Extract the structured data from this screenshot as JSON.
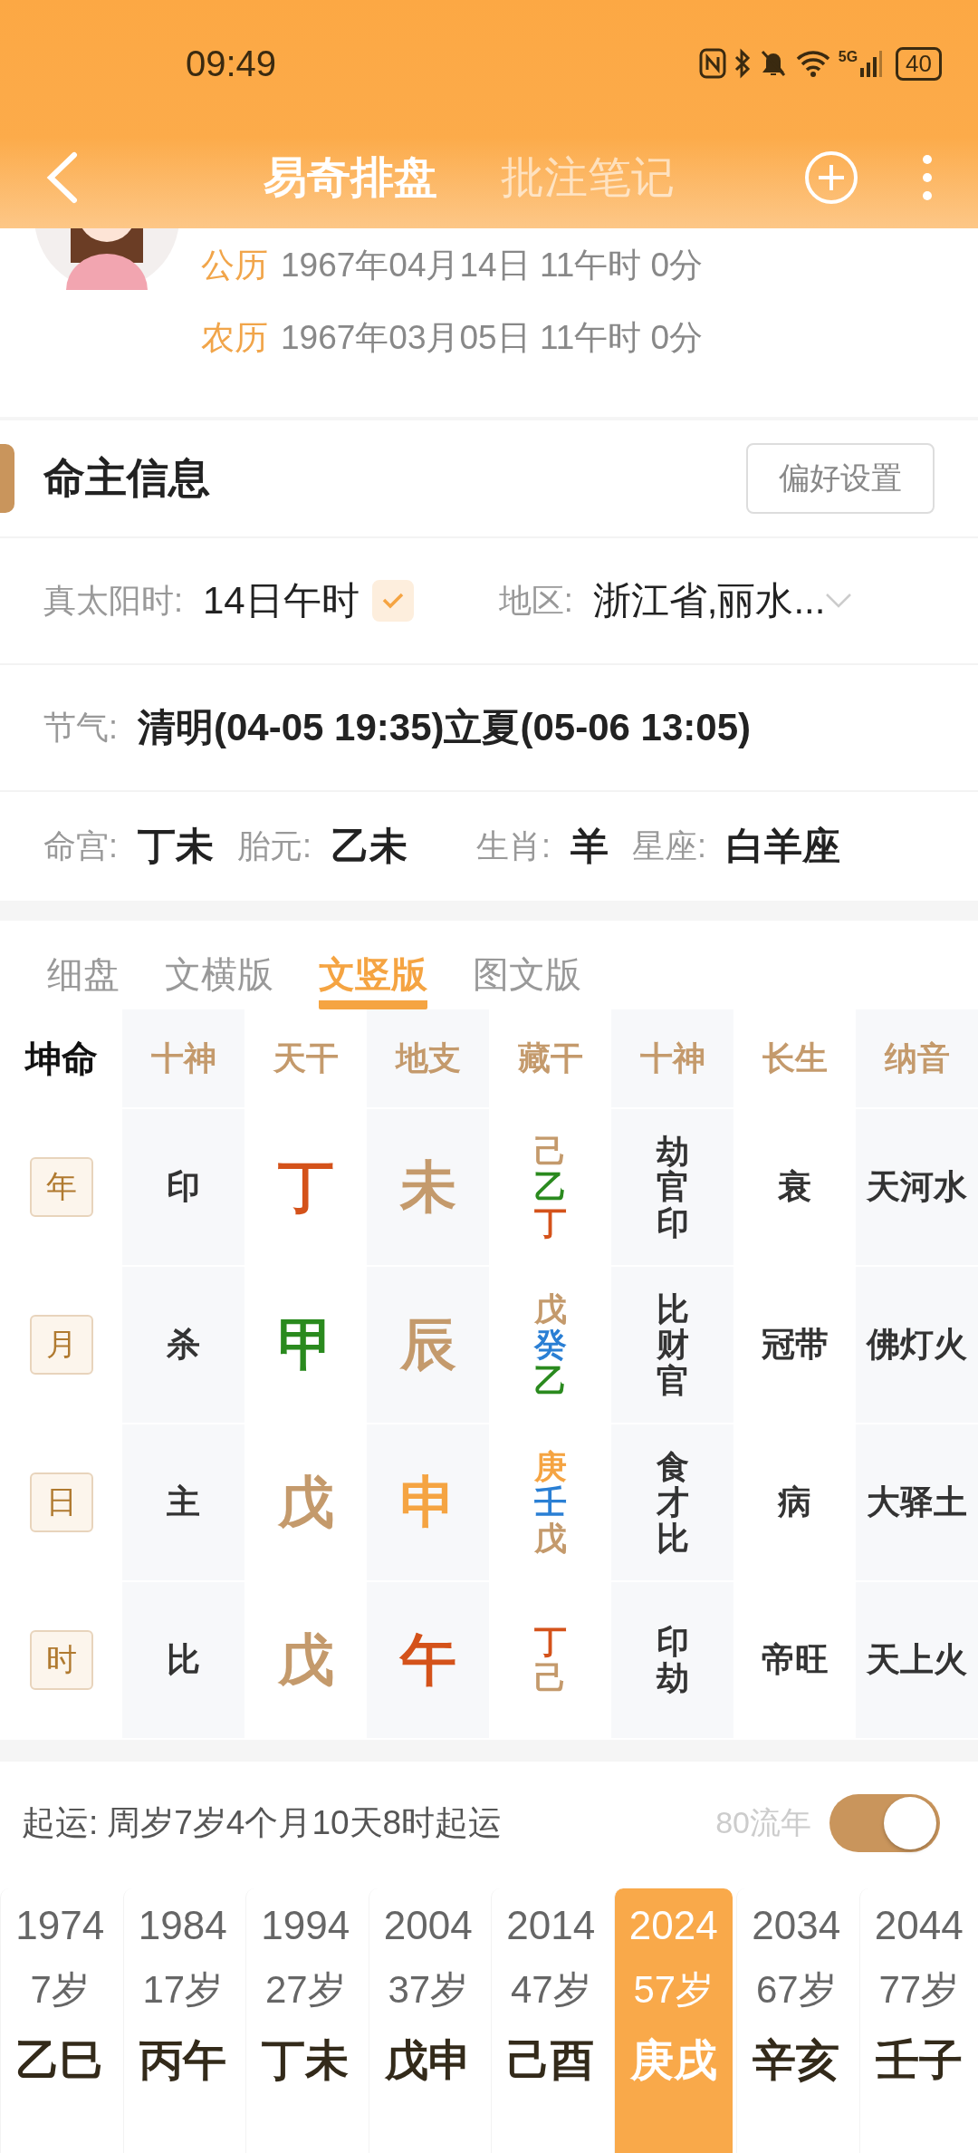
{
  "status_bar": {
    "time": "09:49",
    "network": "5G",
    "battery": "40"
  },
  "nav": {
    "tabs": [
      {
        "label": "易奇排盘",
        "selected": true
      },
      {
        "label": "批注笔记",
        "selected": false
      }
    ]
  },
  "profile": {
    "dates": [
      {
        "label": "公历",
        "value": "1967年04月14日 11午时 0分"
      },
      {
        "label": "农历",
        "value": "1967年03月05日 11午时 0分"
      }
    ]
  },
  "info": {
    "title": "命主信息",
    "button": "偏好设置",
    "solar_time": {
      "label": "真太阳时:",
      "value": "14日午时",
      "checked": true
    },
    "region": {
      "label": "地区:",
      "value": "浙江省,丽水..."
    },
    "solar_terms": {
      "label": "节气:",
      "value": "清明(04-05 19:35)立夏(05-06 13:05)"
    },
    "facts": [
      {
        "label": "命宫:",
        "value": "丁未"
      },
      {
        "label": "胎元:",
        "value": "乙未"
      },
      {
        "label": "生肖:",
        "value": "羊"
      },
      {
        "label": "星座:",
        "value": "白羊座"
      }
    ]
  },
  "view_tabs": [
    {
      "label": "细盘",
      "selected": false
    },
    {
      "label": "文横版",
      "selected": false
    },
    {
      "label": "文竖版",
      "selected": true
    },
    {
      "label": "图文版",
      "selected": false
    }
  ],
  "chart": {
    "corner": "坤命",
    "columns": [
      "十神",
      "天干",
      "地支",
      "藏干",
      "十神",
      "长生",
      "纳音"
    ],
    "pillars": [
      {
        "label": "年",
        "god": "印",
        "stem": {
          "text": "丁",
          "color": "#d4521a"
        },
        "branch": {
          "text": "未",
          "color": "#c49a6c"
        },
        "hidden": [
          {
            "text": "己",
            "color": "#c49a6c"
          },
          {
            "text": "乙",
            "color": "#2a8a1e"
          },
          {
            "text": "丁",
            "color": "#d4521a"
          }
        ],
        "hidden_gods": "劫官印",
        "growth": "衰",
        "nayin": "天河水"
      },
      {
        "label": "月",
        "god": "杀",
        "stem": {
          "text": "甲",
          "color": "#2a8a1e"
        },
        "branch": {
          "text": "辰",
          "color": "#c49a6c"
        },
        "hidden": [
          {
            "text": "戊",
            "color": "#c49a6c"
          },
          {
            "text": "癸",
            "color": "#2a7fd4"
          },
          {
            "text": "乙",
            "color": "#2a8a1e"
          }
        ],
        "hidden_gods": "比财官",
        "growth": "冠带",
        "nayin": "佛灯火"
      },
      {
        "label": "日",
        "god": "主",
        "stem": {
          "text": "戊",
          "color": "#c49a6c"
        },
        "branch": {
          "text": "申",
          "color": "#f5a442"
        },
        "hidden": [
          {
            "text": "庚",
            "color": "#f5a442"
          },
          {
            "text": "壬",
            "color": "#2a7fd4"
          },
          {
            "text": "戊",
            "color": "#c49a6c"
          }
        ],
        "hidden_gods": "食才比",
        "growth": "病",
        "nayin": "大驿土"
      },
      {
        "label": "时",
        "god": "比",
        "stem": {
          "text": "戊",
          "color": "#c49a6c"
        },
        "branch": {
          "text": "午",
          "color": "#d4521a"
        },
        "hidden": [
          {
            "text": "丁",
            "color": "#d4521a"
          },
          {
            "text": "己",
            "color": "#c49a6c"
          }
        ],
        "hidden_gods": "印劫",
        "growth": "帝旺",
        "nayin": "天上火"
      }
    ]
  },
  "luck": {
    "label": "起运:",
    "value": "周岁7岁4个月10天8时起运",
    "toggle_label": "80流年",
    "on": true
  },
  "decades": [
    {
      "year": "1974",
      "age": "7岁",
      "ganzhi": "乙巳",
      "selected": false
    },
    {
      "year": "1984",
      "age": "17岁",
      "ganzhi": "丙午",
      "selected": false
    },
    {
      "year": "1994",
      "age": "27岁",
      "ganzhi": "丁未",
      "selected": false
    },
    {
      "year": "2004",
      "age": "37岁",
      "ganzhi": "戊申",
      "selected": false
    },
    {
      "year": "2014",
      "age": "47岁",
      "ganzhi": "己酉",
      "selected": false
    },
    {
      "year": "2024",
      "age": "57岁",
      "ganzhi": "庚戌",
      "selected": true
    },
    {
      "year": "2034",
      "age": "67岁",
      "ganzhi": "辛亥",
      "selected": false
    },
    {
      "year": "2044",
      "age": "77岁",
      "ganzhi": "壬子",
      "selected": false
    }
  ]
}
